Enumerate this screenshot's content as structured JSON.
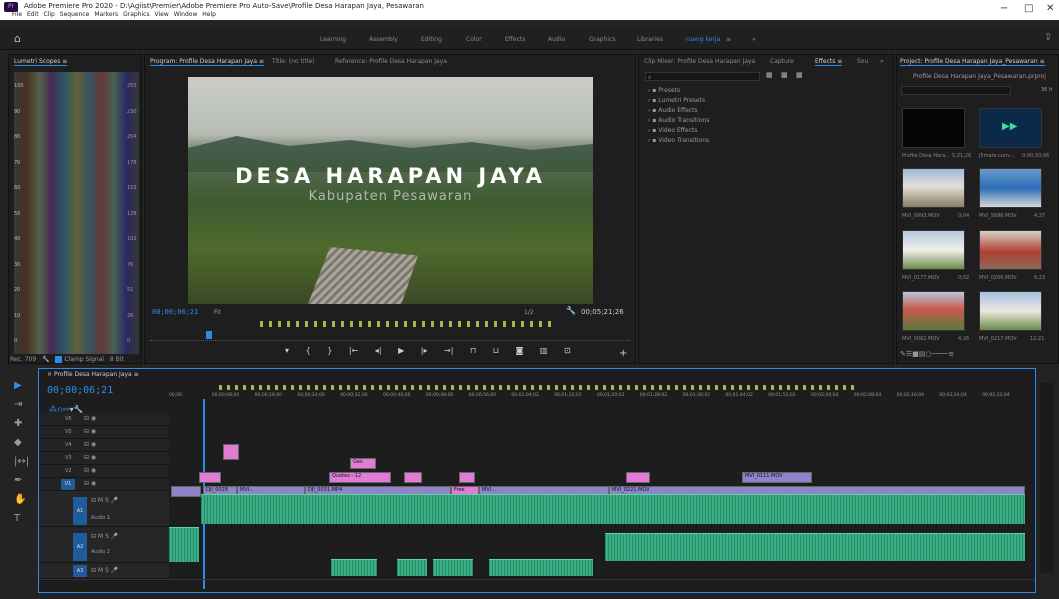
{
  "window": {
    "title": "Adobe Premiere Pro 2020 - D:\\Agiist\\Premier\\Adobe Premiere Pro Auto-Save\\Profile Desa Harapan Jaya, Pesawaran",
    "menu": [
      "File",
      "Edit",
      "Clip",
      "Sequence",
      "Markers",
      "Graphics",
      "View",
      "Window",
      "Help"
    ],
    "controls": [
      "−",
      "□",
      "✕"
    ]
  },
  "workspaces": [
    "Learning",
    "Assembly",
    "Editing",
    "Color",
    "Effects",
    "Audio",
    "Graphics",
    "Libraries",
    "ruang kerja",
    "≡",
    "»"
  ],
  "left_panel": {
    "tab": "Lumetri Scopes ≡",
    "scale_right": [
      "255",
      "230",
      "204",
      "178",
      "153",
      "128",
      "102",
      "76",
      "51",
      "26",
      "0"
    ],
    "scale_left": [
      "100",
      "90",
      "80",
      "70",
      "60",
      "50",
      "40",
      "30",
      "20",
      "10",
      "0"
    ],
    "footer": "Rec. 709",
    "clamp": "Clamp Signal",
    "bit": "8 Bit"
  },
  "program": {
    "tabs": [
      "Program: Profile Desa Harapan Jaya ≡",
      "Title: (no title)",
      "Reference: Profile Desa Harapan Jaya"
    ],
    "title": "DESA HARAPAN JAYA",
    "subtitle": "Kabupaten Pesawaran",
    "timecode": "00;00;06;21",
    "fit": "Fit",
    "ratio": "1/2",
    "duration": "00;05;21;26"
  },
  "effects_panel": {
    "tabs": [
      "Clip Mixer: Profile Desa Harapan Jaya",
      "Capture",
      "Effects ≡",
      "Sou",
      "»"
    ],
    "items": [
      "Presets",
      "Lumetri Presets",
      "Audio Effects",
      "Audio Transitions",
      "Video Effects",
      "Video Transitions"
    ]
  },
  "project_panel": {
    "tab": "Project: Profile Desa Harapan Jaya_Pesawaran ≡",
    "file": "Profile Desa Harapan Jaya_Pesawaran.prproj",
    "count": "36 It",
    "items": [
      {
        "name": "Profile Desa Hara...",
        "dur": "5;21;26"
      },
      {
        "name": "j5mate.com-...",
        "dur": "0;00;30;06"
      },
      {
        "name": "MVI_9993.MOV",
        "dur": "0;04"
      },
      {
        "name": "MVI_9996.MOV",
        "dur": "4;27"
      },
      {
        "name": "MVI_0177.MOV",
        "dur": "0;02"
      },
      {
        "name": "MVI_0206.MOV",
        "dur": "6;23"
      },
      {
        "name": "MVI_0062.MOV",
        "dur": "4;26"
      },
      {
        "name": "MVI_0217.MOV",
        "dur": "12;21"
      }
    ]
  },
  "timeline": {
    "tab": "Profile Desa Harapan Jaya ≡",
    "timecode": "00;00;06;21",
    "ruler": [
      "00;00",
      "00;00;08;00",
      "00;00;16;00",
      "00;00;24;00",
      "00;00;32;00",
      "00;00;40;00",
      "00;00;48;00",
      "00;00;56;00",
      "00;01;04;02",
      "00;01;12;02",
      "00;01;20;02",
      "00;01;28;02",
      "00;01;36;02",
      "00;01;44;02",
      "00;01;52;02",
      "00;02;00;04",
      "00;02;08;04",
      "00;02;16;04",
      "00;02;24;04",
      "00;02;32;04"
    ],
    "video_tracks": [
      "V6",
      "V5",
      "V4",
      "V3",
      "V2",
      "V1"
    ],
    "audio_tracks": [
      {
        "id": "A1",
        "name": "Audio 1"
      },
      {
        "id": "A2",
        "name": "Audio 2"
      },
      {
        "id": "A3",
        "name": ""
      }
    ],
    "clip_labels": {
      "c1": "DJI_0028",
      "c2": "MVI...",
      "c3": "DJI_0031.MP4",
      "c4": "MVI_0221.MOV",
      "c5": "MVI_0111.MOV",
      "c6": "Quotes - 12",
      "c7": "Ges",
      "c8": "Free",
      "c9": "MVI..."
    }
  },
  "colors": {
    "accent": "#2d8ceb",
    "video_clip": "#8e84c9",
    "graphic_clip": "#e07bd6",
    "audio_clip": "#37b086",
    "marker": "#b2b24a"
  }
}
